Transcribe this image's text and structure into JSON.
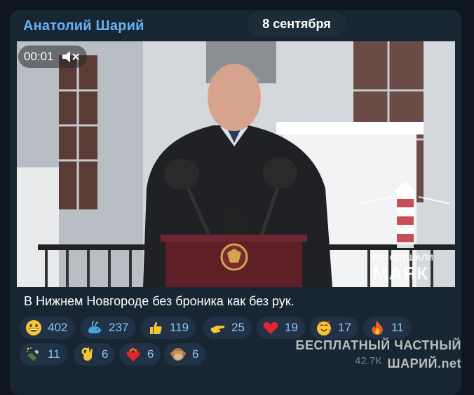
{
  "channel_name": "Анатолий Шарий",
  "date_label": "8 сентября",
  "video": {
    "time": "00:01",
    "watermark_line1": "ВЫ СЛУШАЛИ",
    "watermark_line2": "МАЯК"
  },
  "caption": "В Нижнем Новгороде без броника как без рук.",
  "reactions": [
    {
      "emoji": "grinning-face",
      "count": "402"
    },
    {
      "emoji": "spouting-whale",
      "count": "237"
    },
    {
      "emoji": "thumbs-up",
      "count": "119"
    },
    {
      "emoji": "pointing-hand",
      "count": "25"
    },
    {
      "emoji": "red-heart",
      "count": "19"
    },
    {
      "emoji": "smiling-face-with-hearts",
      "count": "17"
    },
    {
      "emoji": "fire",
      "count": "11"
    },
    {
      "emoji": "champagne",
      "count": "11"
    },
    {
      "emoji": "ok-hand",
      "count": "6"
    },
    {
      "emoji": "heart-on-fire",
      "count": "6"
    },
    {
      "emoji": "see-no-evil-monkey",
      "count": "6"
    }
  ],
  "footer": {
    "views": "42.7К",
    "watermark_line1": "БЕСПЛАТНЫЙ ЧАСТНЫЙ",
    "watermark_line2": "ШАРИЙ.net"
  },
  "colors": {
    "background": "#0e1621",
    "bubble": "#182533",
    "link": "#6ab2f2",
    "reaction_bg": "#213246",
    "reaction_text": "#8ec3f3"
  }
}
